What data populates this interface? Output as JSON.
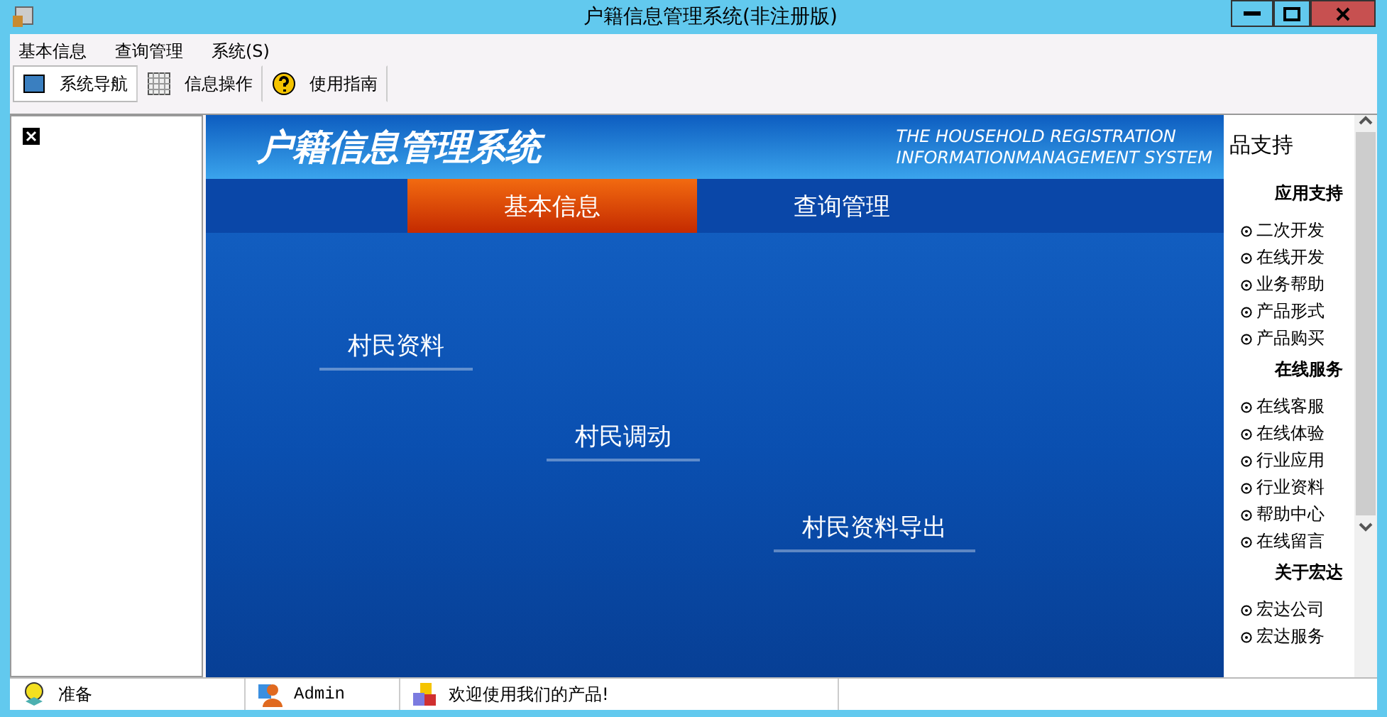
{
  "window": {
    "title": "户籍信息管理系统(非注册版)"
  },
  "menu": [
    "基本信息",
    "查询管理",
    "系统(S)"
  ],
  "toolbar": [
    {
      "label": "系统导航",
      "selected": true
    },
    {
      "label": "信息操作",
      "selected": false
    },
    {
      "label": "使用指南",
      "selected": false
    }
  ],
  "banner": {
    "logo": "户籍信息管理系统",
    "english_top": "THE HOUSEHOLD REGISTRATION",
    "english": "INFORMATIONMANAGEMENT SYSTEM"
  },
  "nav": [
    {
      "label": "基本信息",
      "selected": true
    },
    {
      "label": "查询管理",
      "selected": false
    }
  ],
  "links": [
    "村民资料",
    "村民调动",
    "村民资料导出"
  ],
  "side": {
    "title": "品支持",
    "sections": [
      {
        "heading": "应用支持",
        "items": [
          "二次开发",
          "在线开发",
          "业务帮助",
          "产品形式",
          "产品购买"
        ]
      },
      {
        "heading": "在线服务",
        "items": [
          "在线客服",
          "在线体验",
          "行业应用",
          "行业资料",
          "帮助中心",
          "在线留言"
        ]
      },
      {
        "heading": "关于宏达",
        "items": [
          "宏达公司",
          "宏达服务"
        ]
      }
    ]
  },
  "status": [
    "准备",
    "Admin",
    "欢迎使用我们的产品!"
  ]
}
